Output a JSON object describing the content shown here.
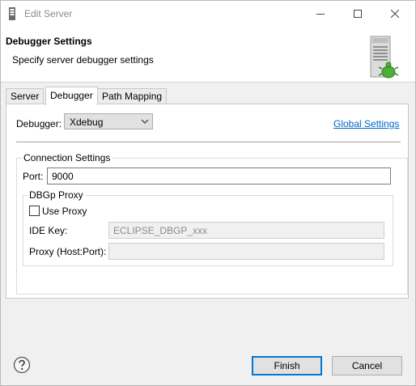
{
  "window": {
    "title": "Edit Server"
  },
  "header": {
    "title": "Debugger Settings",
    "description": "Specify server debugger settings"
  },
  "tabs": [
    {
      "label": "Server",
      "active": false
    },
    {
      "label": "Debugger",
      "active": true
    },
    {
      "label": "Path Mapping",
      "active": false
    }
  ],
  "debugger": {
    "label": "Debugger:",
    "selected": "Xdebug",
    "global_settings_link": "Global Settings"
  },
  "connection": {
    "legend": "Connection Settings",
    "port_label": "Port:",
    "port_value": "9000",
    "proxy": {
      "legend": "DBGp Proxy",
      "use_proxy_label": "Use Proxy",
      "use_proxy_checked": false,
      "ide_key_label": "IDE Key:",
      "ide_key_value": "ECLIPSE_DBGP_xxx",
      "host_port_label": "Proxy (Host:Port):",
      "host_port_value": ""
    }
  },
  "footer": {
    "finish_label": "Finish",
    "cancel_label": "Cancel"
  },
  "colors": {
    "link": "#0066cc",
    "default_button_border": "#0078d7"
  }
}
